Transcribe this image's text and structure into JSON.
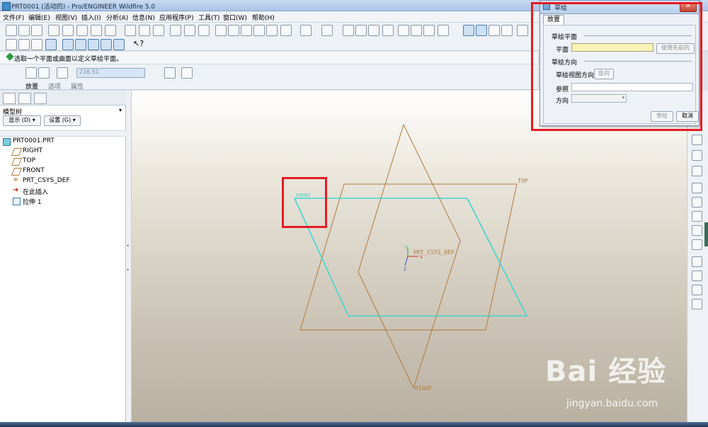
{
  "window": {
    "title": "PRT0001 (活动的) - Pro/ENGINEER Wildfire 5.0"
  },
  "menu": [
    "文件(F)",
    "编辑(E)",
    "视图(V)",
    "插入(I)",
    "分析(A)",
    "信息(N)",
    "应用程序(P)",
    "工具(T)",
    "窗口(W)",
    "帮助(H)"
  ],
  "message": "选取一个平面或曲面以定义草绘平面。",
  "dashboard": {
    "value": "216.51",
    "tabs": [
      "放置",
      "选项",
      "属性"
    ]
  },
  "model_tree": {
    "title": "模型树",
    "show_btn": "显示 (D) ▾",
    "settings_btn": "设置 (G) ▾",
    "nodes": [
      "PRT0001.PRT",
      "RIGHT",
      "TOP",
      "FRONT",
      "PRT_CSYS_DEF",
      "在此插入",
      "拉伸 1"
    ]
  },
  "graphics": {
    "plane_top": "TOP",
    "plane_right": "RIGHT",
    "plane_front": "FRONT",
    "csys": "PRT_CSYS_DEF",
    "axis_x": "X",
    "axis_y": "Y",
    "axis_z": "Z"
  },
  "dialog": {
    "title": "草绘",
    "close": "✕",
    "tab": "放置",
    "section_plane": "草绘平面",
    "plane_label": "平面",
    "use_prev": "使用先前的",
    "section_orient": "草绘方向",
    "view_dir_label": "草绘视图方向",
    "flip": "反向",
    "reference_label": "参照",
    "orientation_label": "方向",
    "sketch_btn": "草绘",
    "cancel_btn": "取消"
  },
  "watermark": {
    "logo": "Bai 经验",
    "url": "jingyan.baidu.com"
  },
  "colors": {
    "accent_red": "#e51c23",
    "datum": "#b07a3a",
    "selected": "#3fd6d0"
  }
}
